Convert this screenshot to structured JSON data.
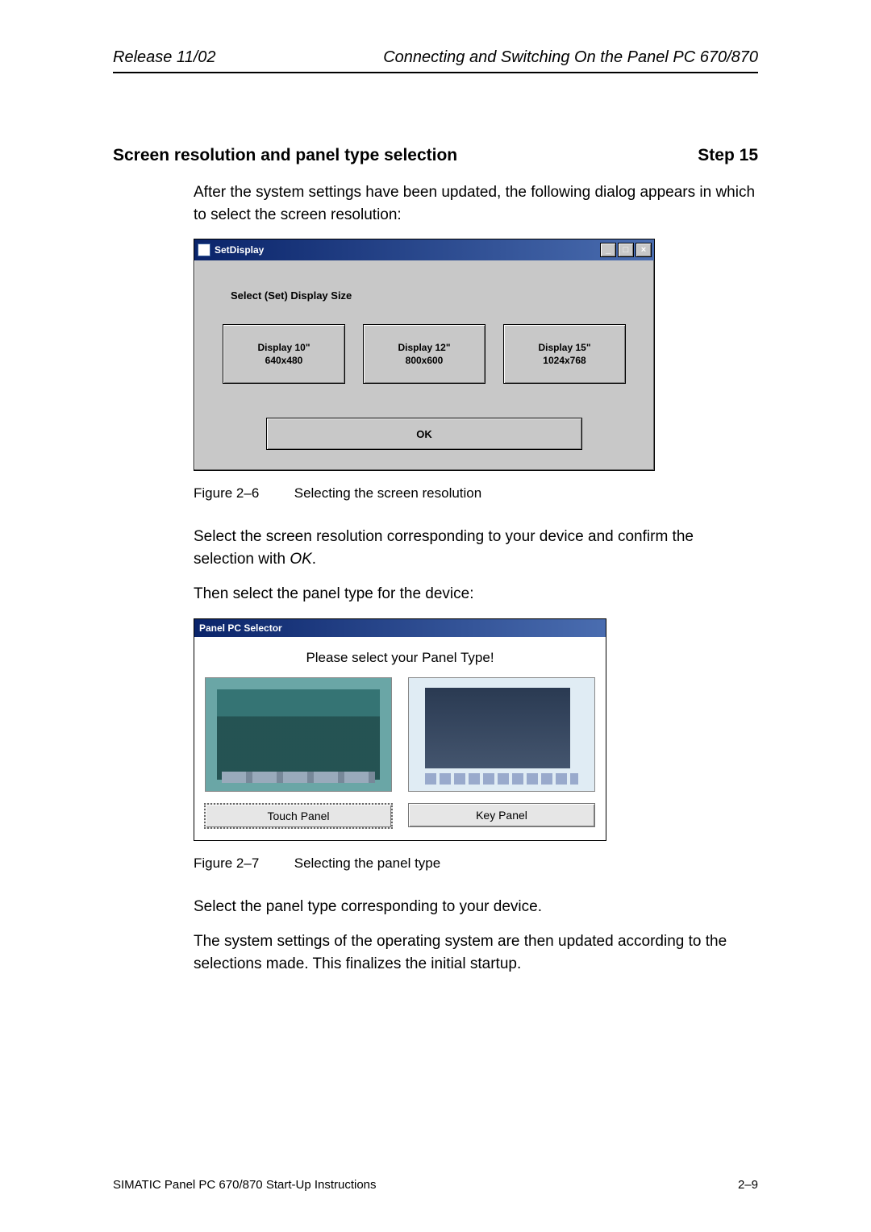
{
  "header": {
    "left": "Release 11/02",
    "right": "Connecting and Switching On the Panel PC 670/870"
  },
  "section": {
    "title": "Screen resolution and panel type selection",
    "step": "Step 15"
  },
  "para1": "After the system settings have been updated, the following dialog appears in which to select the screen resolution:",
  "setdisplay": {
    "title": "SetDisplay",
    "label": "Select (Set) Display Size",
    "buttons": [
      {
        "line1": "Display 10\"",
        "line2": "640x480"
      },
      {
        "line1": "Display 12\"",
        "line2": "800x600"
      },
      {
        "line1": "Display 15\"",
        "line2": "1024x768"
      }
    ],
    "ok": "OK"
  },
  "caption1": {
    "num": "Figure 2–6",
    "text": "Selecting the screen resolution"
  },
  "para2a": "Select the screen resolution corresponding to your device and confirm the selection with ",
  "para2b": "OK",
  "para2c": ".",
  "para3": "Then select the panel type for the device:",
  "selector": {
    "title": "Panel PC Selector",
    "message": "Please select your Panel Type!",
    "touch": "Touch Panel",
    "key": "Key Panel"
  },
  "caption2": {
    "num": "Figure 2–7",
    "text": "Selecting the panel type"
  },
  "para4": "Select the panel type corresponding to your device.",
  "para5": "The system settings of the operating system are then updated according to the selections made. This finalizes the initial startup.",
  "footer": {
    "left": "SIMATIC Panel PC 670/870 Start-Up Instructions",
    "right": "2–9"
  }
}
